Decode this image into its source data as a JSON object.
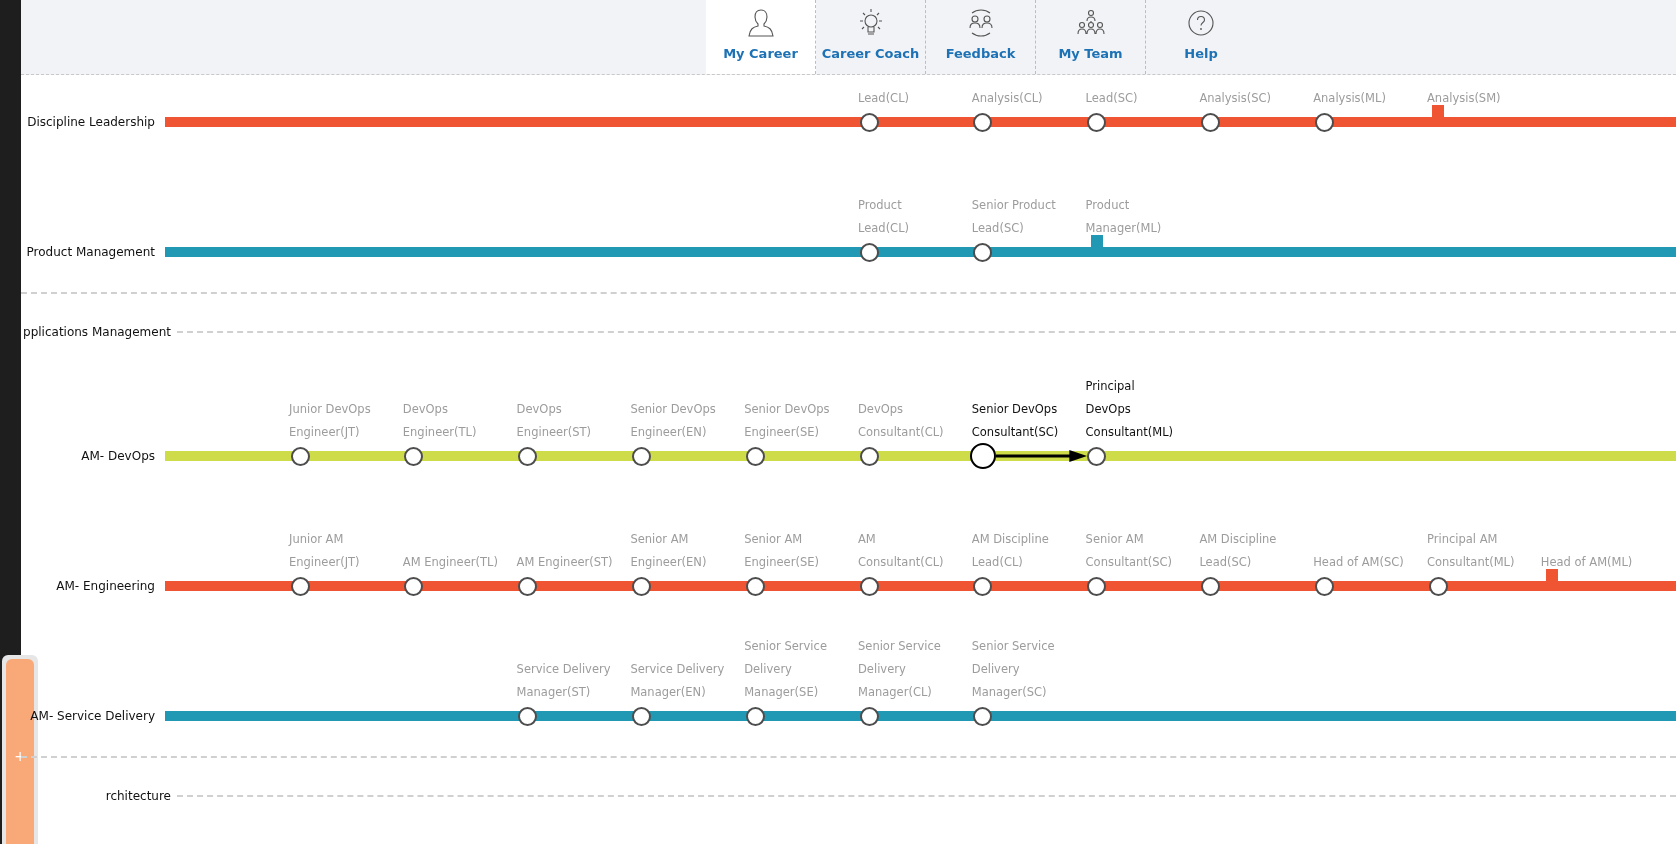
{
  "tabs": [
    {
      "label": "My Career",
      "selected": true
    },
    {
      "label": "Career Coach",
      "selected": false
    },
    {
      "label": "Feedback",
      "selected": false
    },
    {
      "label": "My Team",
      "selected": false
    },
    {
      "label": "Help",
      "selected": false
    }
  ],
  "sections": [
    {
      "kind": "track",
      "label": "Discipline Leadership",
      "color": "#f05533",
      "nodes": [
        {
          "kind": "node",
          "label": "Lead(CL)",
          "current": false,
          "next": false
        },
        {
          "kind": "node",
          "label": "Analysis(CL)",
          "current": false,
          "next": false
        },
        {
          "kind": "node",
          "label": "Lead(SC)",
          "current": false,
          "next": false
        },
        {
          "kind": "node",
          "label": "Analysis(SC)",
          "current": false,
          "next": false
        },
        {
          "kind": "node",
          "label": "Analysis(ML)",
          "current": false,
          "next": false
        },
        {
          "kind": "marker",
          "label": "Analysis(SM)",
          "current": false,
          "next": false
        }
      ]
    },
    {
      "kind": "track",
      "label": "Product Management",
      "color": "#2199b4",
      "nodes": [
        {
          "kind": "node",
          "label": "Product\nLead(CL)",
          "current": false,
          "next": false
        },
        {
          "kind": "node",
          "label": "Senior Product\nLead(SC)",
          "current": false,
          "next": false
        },
        {
          "kind": "marker",
          "label": "Product\nManager(ML)",
          "current": false,
          "next": false
        }
      ]
    },
    {
      "kind": "divider"
    },
    {
      "kind": "group",
      "label": "pplications Management"
    },
    {
      "kind": "track",
      "label": "AM- DevOps",
      "color": "#cddc48",
      "nodes": [
        {
          "kind": "node",
          "label": "Junior DevOps\nEngineer(JT)",
          "current": false,
          "next": false
        },
        {
          "kind": "node",
          "label": "DevOps\nEngineer(TL)",
          "current": false,
          "next": false
        },
        {
          "kind": "node",
          "label": "DevOps\nEngineer(ST)",
          "current": false,
          "next": false
        },
        {
          "kind": "node",
          "label": "Senior DevOps\nEngineer(EN)",
          "current": false,
          "next": false
        },
        {
          "kind": "node",
          "label": "Senior DevOps\nEngineer(SE)",
          "current": false,
          "next": false
        },
        {
          "kind": "node",
          "label": "DevOps\nConsultant(CL)",
          "current": false,
          "next": false
        },
        {
          "kind": "node",
          "label": "Senior DevOps\nConsultant(SC)",
          "current": true,
          "next": false
        },
        {
          "kind": "node",
          "label": "Principal\nDevOps\nConsultant(ML)",
          "current": false,
          "next": true
        }
      ]
    },
    {
      "kind": "track",
      "label": "AM- Engineering",
      "color": "#f05533",
      "nodes": [
        {
          "kind": "node",
          "label": "Junior AM\nEngineer(JT)",
          "current": false,
          "next": false
        },
        {
          "kind": "node",
          "label": "AM Engineer(TL)",
          "current": false,
          "next": false
        },
        {
          "kind": "node",
          "label": "AM Engineer(ST)",
          "current": false,
          "next": false
        },
        {
          "kind": "node",
          "label": "Senior AM\nEngineer(EN)",
          "current": false,
          "next": false
        },
        {
          "kind": "node",
          "label": "Senior AM\nEngineer(SE)",
          "current": false,
          "next": false
        },
        {
          "kind": "node",
          "label": "AM\nConsultant(CL)",
          "current": false,
          "next": false
        },
        {
          "kind": "node",
          "label": "AM Discipline\nLead(CL)",
          "current": false,
          "next": false
        },
        {
          "kind": "node",
          "label": "Senior AM\nConsultant(SC)",
          "current": false,
          "next": false
        },
        {
          "kind": "node",
          "label": "AM Discipline\nLead(SC)",
          "current": false,
          "next": false
        },
        {
          "kind": "node",
          "label": "Head of AM(SC)",
          "current": false,
          "next": false
        },
        {
          "kind": "node",
          "label": "Principal AM\nConsultant(ML)",
          "current": false,
          "next": false
        },
        {
          "kind": "marker",
          "label": "Head of AM(ML)",
          "current": false,
          "next": false
        }
      ]
    },
    {
      "kind": "track",
      "label": "AM- Service Delivery",
      "color": "#2199b4",
      "nodes": [
        {
          "kind": "node",
          "label": "Service Delivery\nManager(ST)",
          "current": false,
          "next": false
        },
        {
          "kind": "node",
          "label": "Service Delivery\nManager(EN)",
          "current": false,
          "next": false
        },
        {
          "kind": "node",
          "label": "Senior Service\nDelivery\nManager(SE)",
          "current": false,
          "next": false
        },
        {
          "kind": "node",
          "label": "Senior Service\nDelivery\nManager(CL)",
          "current": false,
          "next": false
        },
        {
          "kind": "node",
          "label": "Senior Service\nDelivery\nManager(SC)",
          "current": false,
          "next": false
        }
      ]
    },
    {
      "kind": "divider"
    },
    {
      "kind": "group",
      "label": "rchitecture"
    }
  ],
  "floating_panel": {
    "button": "+"
  }
}
